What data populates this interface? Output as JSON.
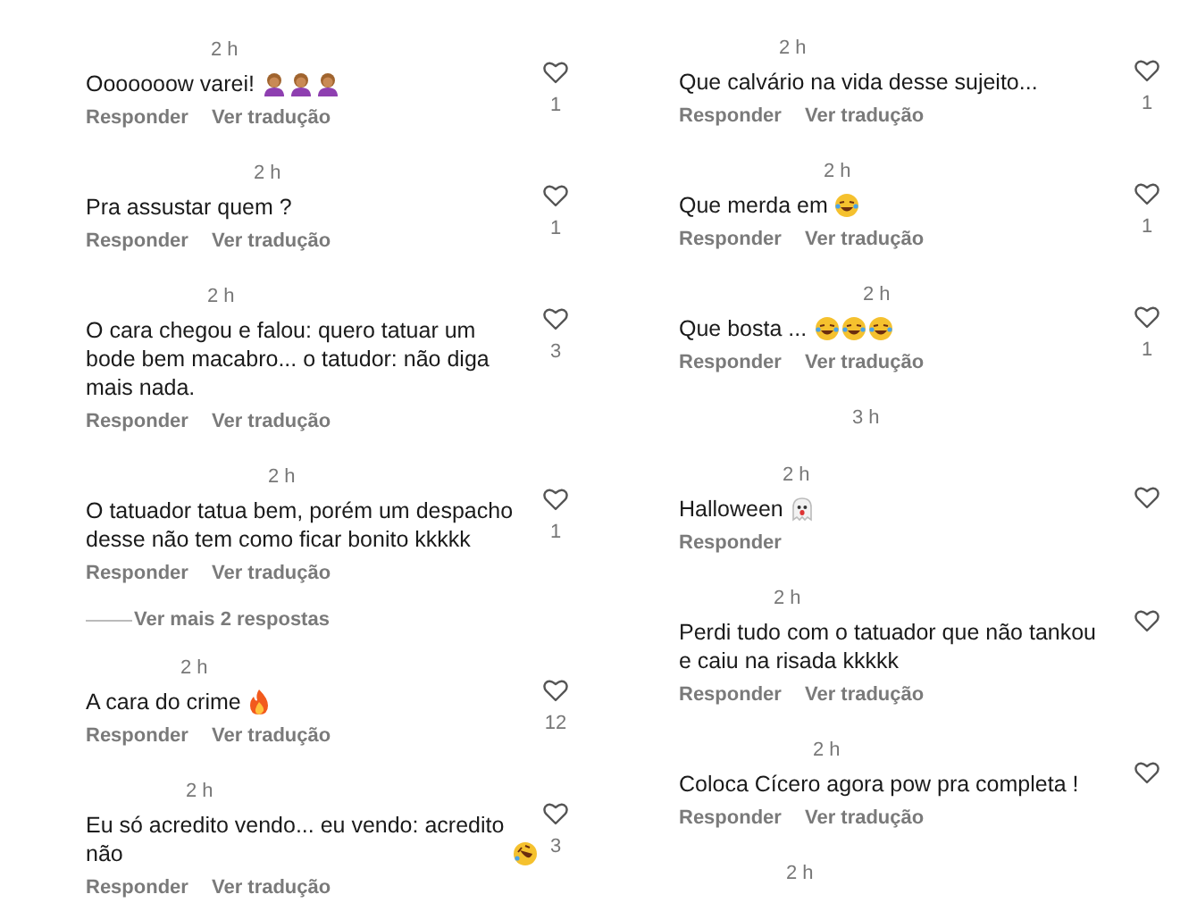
{
  "columns": [
    {
      "comments": [
        {
          "time": "2 h",
          "text": "Ooooooow varei!",
          "emojis": [
            {
              "kind": "person"
            },
            {
              "kind": "person"
            },
            {
              "kind": "person"
            }
          ],
          "actions": [
            "Responder",
            "Ver tradução"
          ],
          "likes": "1"
        },
        {
          "time": "2 h",
          "text": "Pra assustar quem ?",
          "actions": [
            "Responder",
            "Ver tradução"
          ],
          "likes": "1"
        },
        {
          "time": "2 h",
          "text": "O cara chegou e falou: quero tatuar um bode bem macabro... o tatudor: não diga mais nada.",
          "actions": [
            "Responder",
            "Ver tradução"
          ],
          "likes": "3"
        },
        {
          "time": "2 h",
          "text": "O tatuador tatua bem, porém um despacho desse não tem como ficar bonito kkkkk",
          "actions": [
            "Responder",
            "Ver tradução"
          ],
          "likes": "1",
          "more_replies": "Ver mais 2 respostas"
        },
        {
          "time": "2 h",
          "text": "A cara do crime",
          "emojis": [
            {
              "kind": "fire"
            }
          ],
          "actions": [
            "Responder",
            "Ver tradução"
          ],
          "likes": "12"
        },
        {
          "time": "2 h",
          "text": "Eu só acredito vendo... eu vendo: acredito não",
          "emojis": [
            {
              "kind": "rofl"
            }
          ],
          "actions": [
            "Responder",
            "Ver tradução"
          ],
          "likes": "3"
        }
      ]
    },
    {
      "comments": [
        {
          "time": "2 h",
          "text": "Que calvário na vida desse sujeito...",
          "actions": [
            "Responder",
            "Ver tradução"
          ],
          "likes": "1"
        },
        {
          "time": "2 h",
          "text": "Que merda em",
          "emojis": [
            {
              "kind": "laughing"
            }
          ],
          "actions": [
            "Responder",
            "Ver tradução"
          ],
          "likes": "1"
        },
        {
          "time": "2 h",
          "text": "Que bosta ...",
          "emojis": [
            {
              "kind": "laughing"
            },
            {
              "kind": "laughing"
            },
            {
              "kind": "laughing"
            }
          ],
          "actions": [
            "Responder",
            "Ver tradução"
          ],
          "likes": "1"
        },
        {
          "time": "3 h"
        },
        {
          "time": "2 h",
          "text": "Halloween",
          "emojis": [
            {
              "kind": "ghost"
            }
          ],
          "actions": [
            "Responder"
          ]
        },
        {
          "time": "2 h",
          "text": "Perdi tudo com o tatuador que não tankou e caiu na risada kkkkk",
          "actions": [
            "Responder",
            "Ver tradução"
          ]
        },
        {
          "time": "2 h",
          "text": "Coloca Cícero agora pow pra completa !",
          "actions": [
            "Responder",
            "Ver tradução"
          ]
        },
        {
          "time": "2 h"
        }
      ]
    }
  ]
}
